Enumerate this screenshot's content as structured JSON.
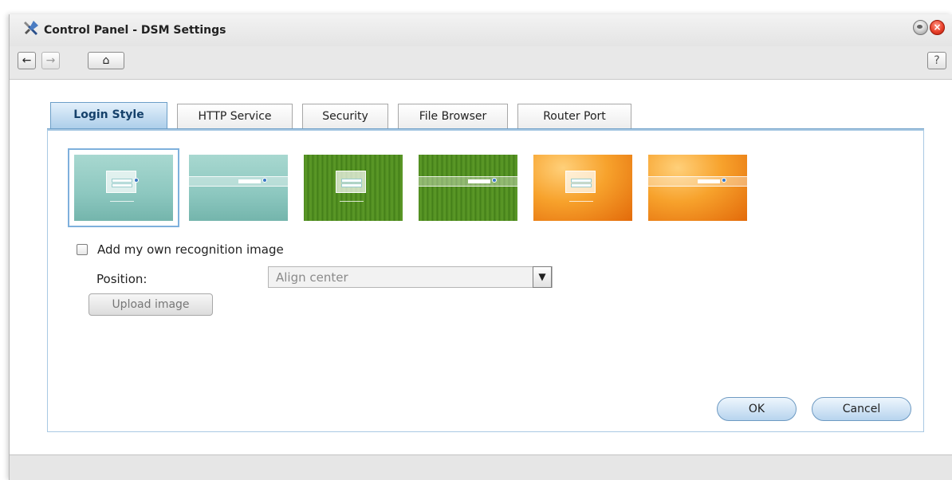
{
  "window": {
    "title": "Control Panel - DSM Settings",
    "close_glyph": "×"
  },
  "toolbar": {
    "back_glyph": "←",
    "forward_glyph": "→",
    "home_glyph": "⌂",
    "help_glyph": "?"
  },
  "tabs": [
    {
      "label": "Login Style",
      "active": true
    },
    {
      "label": "HTTP Service",
      "active": false
    },
    {
      "label": "Security",
      "active": false
    },
    {
      "label": "File Browser",
      "active": false
    },
    {
      "label": "Router Port",
      "active": false
    }
  ],
  "login_style": {
    "themes": [
      "teal",
      "teal",
      "green",
      "green",
      "orange",
      "orange"
    ],
    "selected_index": 0,
    "own_image_checkbox_label": "Add my own recognition image",
    "own_image_checked": false,
    "position_label": "Position:",
    "position_value": "Align center",
    "upload_label": "Upload image"
  },
  "actions": {
    "ok_label": "OK",
    "cancel_label": "Cancel"
  },
  "colors": {
    "tab_active": "#a8cbe8",
    "panel_border": "#a9c9e3",
    "teal": "#8cc7bf",
    "green": "#4e8a1f",
    "orange": "#f7a22c"
  }
}
